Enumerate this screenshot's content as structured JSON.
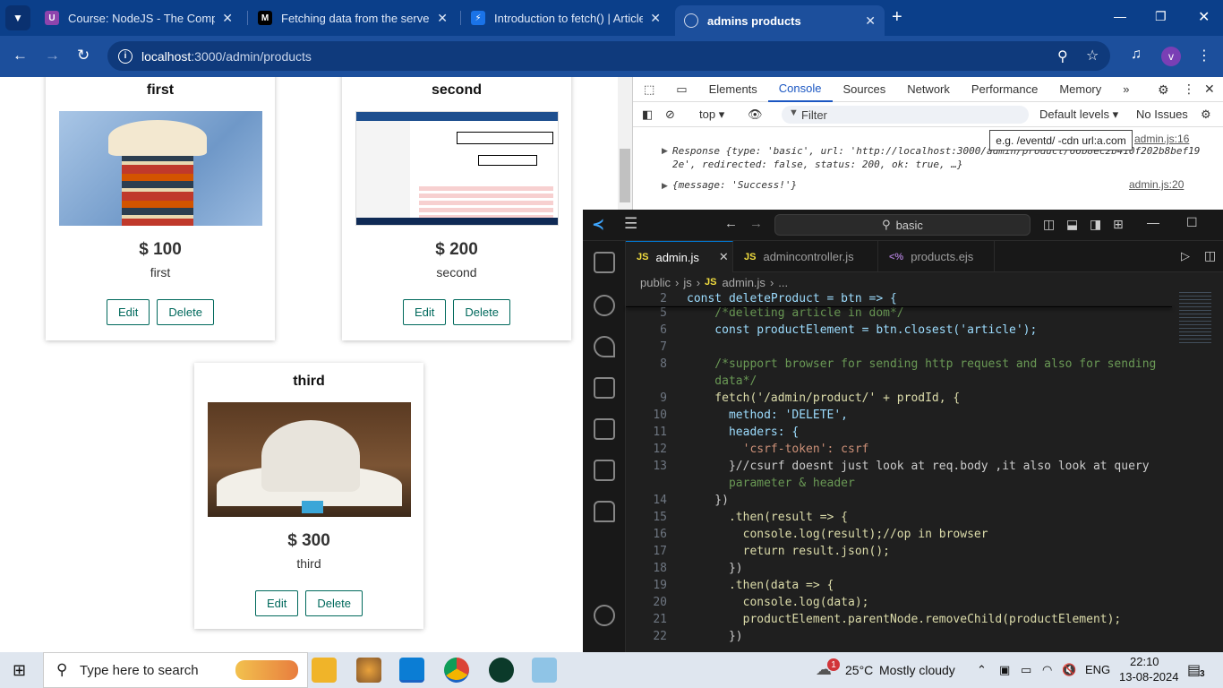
{
  "browser": {
    "tabs": [
      {
        "title": "Course: NodeJS - The Complete",
        "icon": "udemy-icon"
      },
      {
        "title": "Fetching data from the server -",
        "icon": "medium-icon"
      },
      {
        "title": "Introduction to fetch()  |  Article",
        "icon": "chrome-dev-icon"
      },
      {
        "title": "admins products",
        "icon": "globe-icon",
        "active": true
      }
    ],
    "url_host": "localhost",
    "url_path": ":3000/admin/products",
    "profile_initial": "v"
  },
  "page": {
    "products": [
      {
        "title": "first",
        "price": "$ 100",
        "description": "first"
      },
      {
        "title": "second",
        "price": "$ 200",
        "description": "second"
      },
      {
        "title": "third",
        "price": "$ 300",
        "description": "third"
      }
    ],
    "edit_label": "Edit",
    "delete_label": "Delete"
  },
  "devtools": {
    "tabs": [
      "Elements",
      "Console",
      "Sources",
      "Network",
      "Performance",
      "Memory"
    ],
    "active_tab": "Console",
    "context": "top",
    "filter_placeholder": "Filter",
    "levels": "Default levels",
    "issues": "No Issues",
    "tooltip": "e.g. /eventd/ -cdn url:a.com",
    "logs": [
      {
        "line1": "Response {type: 'basic', url: 'http://localhost:3000/admin/product/66b8ec2b410f202b8bef19",
        "line2": "2e', redirected: false, status: 200, ok: true, …}",
        "source": "admin.js:16"
      },
      {
        "line1": "{message: 'Success!'}",
        "source": "admin.js:20"
      }
    ]
  },
  "vscode": {
    "search": "basic",
    "tabs": [
      {
        "label": "admin.js",
        "icon": "JS",
        "active": true
      },
      {
        "label": "admincontroller.js",
        "icon": "JS"
      },
      {
        "label": "products.ejs",
        "icon": "<%"
      }
    ],
    "breadcrumb": [
      "public",
      "js",
      "admin.js",
      "..."
    ],
    "code": [
      {
        "n": "2",
        "t": "const deleteProduct = btn => {"
      },
      {
        "n": "5",
        "t": "    /*deleting article in dom*/"
      },
      {
        "n": "6",
        "t": "    const productElement = btn.closest('article');"
      },
      {
        "n": "7",
        "t": ""
      },
      {
        "n": "8",
        "t": "    /*support browser for sending http request and also for sending"
      },
      {
        "n": "",
        "t": "    data*/"
      },
      {
        "n": "9",
        "t": "    fetch('/admin/product/' + prodId, {"
      },
      {
        "n": "10",
        "t": "      method: 'DELETE',"
      },
      {
        "n": "11",
        "t": "      headers: {"
      },
      {
        "n": "12",
        "t": "        'csrf-token': csrf"
      },
      {
        "n": "13",
        "t": "      }//csurf doesnt just look at req.body ,it also look at query"
      },
      {
        "n": "",
        "t": "      parameter & header"
      },
      {
        "n": "14",
        "t": "    })"
      },
      {
        "n": "15",
        "t": "      .then(result => {"
      },
      {
        "n": "16",
        "t": "        console.log(result);//op in browser"
      },
      {
        "n": "17",
        "t": "        return result.json();"
      },
      {
        "n": "18",
        "t": "      })"
      },
      {
        "n": "19",
        "t": "      .then(data => {"
      },
      {
        "n": "20",
        "t": "        console.log(data);"
      },
      {
        "n": "21",
        "t": "        productElement.parentNode.removeChild(productElement);"
      },
      {
        "n": "22",
        "t": "      })"
      }
    ]
  },
  "taskbar": {
    "search_placeholder": "Type here to search",
    "weather_temp": "25°C",
    "weather_text": "Mostly cloudy",
    "weather_badge": "1",
    "language": "ENG",
    "time": "22:10",
    "date": "13-08-2024",
    "notification_count": "3"
  }
}
